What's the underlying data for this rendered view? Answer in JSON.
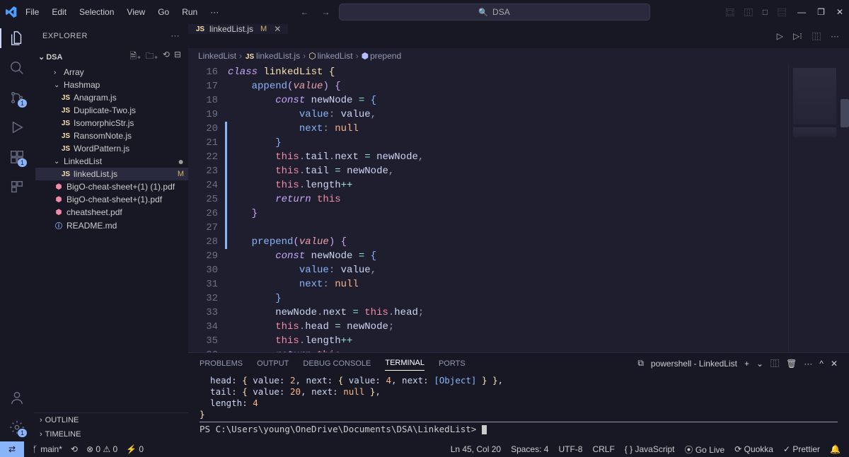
{
  "menu": [
    "File",
    "Edit",
    "Selection",
    "View",
    "Go",
    "Run",
    "···"
  ],
  "nav": {
    "back": "←",
    "fwd": "→"
  },
  "search": {
    "placeholder": "DSA",
    "icon": "🔍"
  },
  "layout_icons": [
    "⿴",
    "⿲",
    "□",
    "⿳"
  ],
  "win": {
    "min": "—",
    "max": "❐",
    "close": "✕"
  },
  "activity": {
    "items": [
      {
        "name": "files-icon",
        "badge": null
      },
      {
        "name": "search-icon",
        "badge": null
      },
      {
        "name": "source-control-icon",
        "badge": "1"
      },
      {
        "name": "run-debug-icon",
        "badge": null
      },
      {
        "name": "extensions-icon",
        "badge": "1"
      },
      {
        "name": "more-icon",
        "badge": null
      }
    ],
    "bottom": [
      {
        "name": "account-icon"
      },
      {
        "name": "settings-gear-icon",
        "badge": "1"
      }
    ]
  },
  "sidebar": {
    "title": "EXPLORER",
    "root": "DSA",
    "actions": [
      "new-file",
      "new-folder",
      "refresh",
      "collapse"
    ],
    "tree": [
      {
        "kind": "folder",
        "label": "Array",
        "expanded": false,
        "indent": 1
      },
      {
        "kind": "folder",
        "label": "Hashmap",
        "expanded": true,
        "indent": 1
      },
      {
        "kind": "file",
        "label": "Anagram.js",
        "icon": "JS",
        "indent": 2
      },
      {
        "kind": "file",
        "label": "Duplicate-Two.js",
        "icon": "JS",
        "indent": 2
      },
      {
        "kind": "file",
        "label": "IsomorphicStr.js",
        "icon": "JS",
        "indent": 2
      },
      {
        "kind": "file",
        "label": "RansomNote.js",
        "icon": "JS",
        "indent": 2
      },
      {
        "kind": "file",
        "label": "WordPattern.js",
        "icon": "JS",
        "indent": 2
      },
      {
        "kind": "folder",
        "label": "LinkedList",
        "expanded": true,
        "indent": 1,
        "mod": "dot"
      },
      {
        "kind": "file",
        "label": "linkedList.js",
        "icon": "JS",
        "indent": 2,
        "mod": "M",
        "selected": true
      },
      {
        "kind": "file",
        "label": "BigO-cheat-sheet+(1) (1).pdf",
        "icon": "PDF",
        "indent": 1
      },
      {
        "kind": "file",
        "label": "BigO-cheat-sheet+(1).pdf",
        "icon": "PDF",
        "indent": 1
      },
      {
        "kind": "file",
        "label": "cheatsheet.pdf",
        "icon": "PDF",
        "indent": 1
      },
      {
        "kind": "file",
        "label": "README.md",
        "icon": "MD",
        "indent": 1
      }
    ],
    "outline": "OUTLINE",
    "timeline": "TIMELINE"
  },
  "tabs": [
    {
      "icon": "JS",
      "label": "linkedList.js",
      "mod": "M"
    }
  ],
  "tab_actions": {
    "run": "▷",
    "split": "⿲",
    "more": "···"
  },
  "breadcrumbs": [
    {
      "label": "LinkedList",
      "icon": null
    },
    {
      "label": "linkedList.js",
      "icon": "JS"
    },
    {
      "label": "linkedList",
      "icon": "cls"
    },
    {
      "label": "prepend",
      "icon": "method"
    }
  ],
  "code": {
    "first_line": 16,
    "current_line": 45,
    "lines": [
      [
        [
          "kw",
          "class "
        ],
        [
          "id",
          "linkedList "
        ],
        [
          "br1",
          "{"
        ]
      ],
      [
        [
          "sp",
          "    "
        ],
        [
          "fn",
          "append"
        ],
        [
          "br2",
          "("
        ],
        [
          "param",
          "value"
        ],
        [
          "br2",
          ") "
        ],
        [
          "br2",
          "{"
        ]
      ],
      [
        [
          "sp",
          "        "
        ],
        [
          "kw",
          "const "
        ],
        [
          "pr",
          "newNode "
        ],
        [
          "op",
          "= "
        ],
        [
          "br3",
          "{"
        ]
      ],
      [
        [
          "sp",
          "            "
        ],
        [
          "prk",
          "value"
        ],
        [
          "pn",
          ": "
        ],
        [
          "pr",
          "value"
        ],
        [
          "pn",
          ","
        ]
      ],
      [
        [
          "sp",
          "            "
        ],
        [
          "prk",
          "next"
        ],
        [
          "pn",
          ": "
        ],
        [
          "null",
          "null"
        ]
      ],
      [
        [
          "sp",
          "        "
        ],
        [
          "br3",
          "}"
        ]
      ],
      [
        [
          "sp",
          "        "
        ],
        [
          "this",
          "this"
        ],
        [
          "pn",
          "."
        ],
        [
          "pr",
          "tail"
        ],
        [
          "pn",
          "."
        ],
        [
          "pr",
          "next "
        ],
        [
          "op",
          "= "
        ],
        [
          "pr",
          "newNode"
        ],
        [
          "pn",
          ","
        ]
      ],
      [
        [
          "sp",
          "        "
        ],
        [
          "this",
          "this"
        ],
        [
          "pn",
          "."
        ],
        [
          "pr",
          "tail "
        ],
        [
          "op",
          "= "
        ],
        [
          "pr",
          "newNode"
        ],
        [
          "pn",
          ","
        ]
      ],
      [
        [
          "sp",
          "        "
        ],
        [
          "this",
          "this"
        ],
        [
          "pn",
          "."
        ],
        [
          "pr",
          "length"
        ],
        [
          "op",
          "++"
        ]
      ],
      [
        [
          "sp",
          "        "
        ],
        [
          "kw",
          "return "
        ],
        [
          "this",
          "this"
        ]
      ],
      [
        [
          "sp",
          "    "
        ],
        [
          "br2",
          "}"
        ]
      ],
      [
        [
          "sp",
          ""
        ]
      ],
      [
        [
          "sp",
          "    "
        ],
        [
          "fn",
          "prepend"
        ],
        [
          "br2",
          "("
        ],
        [
          "param",
          "value"
        ],
        [
          "br2",
          ") "
        ],
        [
          "br2",
          "{"
        ]
      ],
      [
        [
          "sp",
          "        "
        ],
        [
          "kw",
          "const "
        ],
        [
          "pr",
          "newNode "
        ],
        [
          "op",
          "= "
        ],
        [
          "br3",
          "{"
        ]
      ],
      [
        [
          "sp",
          "            "
        ],
        [
          "prk",
          "value"
        ],
        [
          "pn",
          ": "
        ],
        [
          "pr",
          "value"
        ],
        [
          "pn",
          ","
        ]
      ],
      [
        [
          "sp",
          "            "
        ],
        [
          "prk",
          "next"
        ],
        [
          "pn",
          ": "
        ],
        [
          "null",
          "null"
        ]
      ],
      [
        [
          "sp",
          "        "
        ],
        [
          "br3",
          "}"
        ]
      ],
      [
        [
          "sp",
          "        "
        ],
        [
          "pr",
          "newNode"
        ],
        [
          "pn",
          "."
        ],
        [
          "pr",
          "next "
        ],
        [
          "op",
          "= "
        ],
        [
          "this",
          "this"
        ],
        [
          "pn",
          "."
        ],
        [
          "pr",
          "head"
        ],
        [
          "pn",
          ";"
        ]
      ],
      [
        [
          "sp",
          "        "
        ],
        [
          "this",
          "this"
        ],
        [
          "pn",
          "."
        ],
        [
          "pr",
          "head "
        ],
        [
          "op",
          "= "
        ],
        [
          "pr",
          "newNode"
        ],
        [
          "pn",
          ";"
        ]
      ],
      [
        [
          "sp",
          "        "
        ],
        [
          "this",
          "this"
        ],
        [
          "pn",
          "."
        ],
        [
          "pr",
          "length"
        ],
        [
          "op",
          "++"
        ]
      ],
      [
        [
          "sp",
          "        "
        ],
        [
          "kw",
          "return "
        ],
        [
          "this",
          "this"
        ]
      ],
      [
        [
          "sp",
          "    "
        ],
        [
          "br2",
          "}"
        ]
      ]
    ]
  },
  "panel": {
    "tabs": [
      "PROBLEMS",
      "OUTPUT",
      "DEBUG CONSOLE",
      "TERMINAL",
      "PORTS"
    ],
    "active": "TERMINAL",
    "right": {
      "shell": "powershell - LinkedList",
      "plus": "+",
      "chev": "⌄",
      "split": "⿲",
      "trash": "🗑",
      "more": "···",
      "up": "^",
      "close": "✕"
    },
    "output": [
      [
        [
          "pr",
          "  head: "
        ],
        [
          "br1",
          "{ "
        ],
        [
          "pr",
          "value: "
        ],
        [
          "term-y",
          "2"
        ],
        [
          "pr",
          ", next: "
        ],
        [
          "br1",
          "{ "
        ],
        [
          "pr",
          "value: "
        ],
        [
          "term-y",
          "4"
        ],
        [
          "pr",
          ", next: "
        ],
        [
          "term-b",
          "[Object]"
        ],
        [
          "br1",
          " } }"
        ],
        [
          "pr",
          ","
        ]
      ],
      [
        [
          "pr",
          "  tail: "
        ],
        [
          "br1",
          "{ "
        ],
        [
          "pr",
          "value: "
        ],
        [
          "term-y",
          "20"
        ],
        [
          "pr",
          ", next: "
        ],
        [
          "term-y",
          "null"
        ],
        [
          "br1",
          " }"
        ],
        [
          "pr",
          ","
        ]
      ],
      [
        [
          "pr",
          "  length: "
        ],
        [
          "term-y",
          "4"
        ]
      ],
      [
        [
          "br1",
          "}"
        ]
      ]
    ],
    "prompt": "PS C:\\Users\\young\\OneDrive\\Documents\\DSA\\LinkedList> "
  },
  "status": {
    "remote": "⇄",
    "branch": "main*",
    "sync": "⟲",
    "errors": "⊗ 0 ⚠ 0",
    "ports": "⚡ 0",
    "pos": "Ln 45, Col 20",
    "spaces": "Spaces: 4",
    "enc": "UTF-8",
    "eol": "CRLF",
    "lang": "{ } JavaScript",
    "golive": "⦿ Go Live",
    "quokka": "⟳ Quokka",
    "prettier": "✓ Prettier",
    "bell": "🔔"
  }
}
